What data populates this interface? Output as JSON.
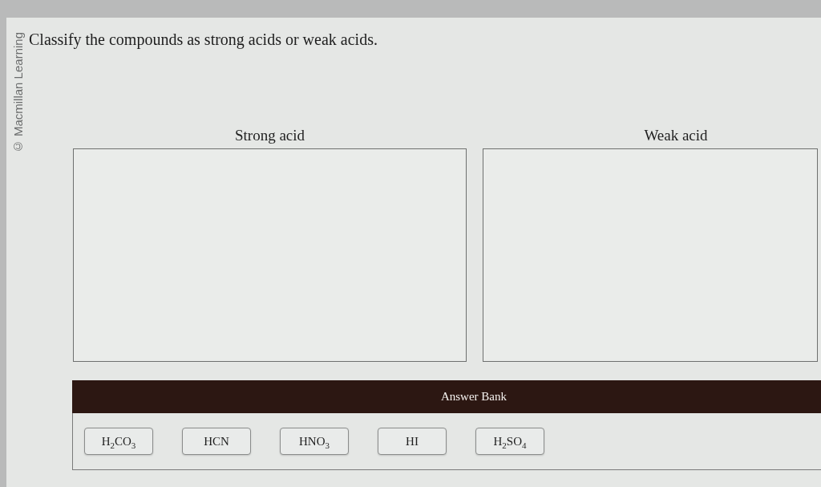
{
  "copyright_notice": "© Macmillan Learning",
  "question": "Classify the compounds as strong acids or weak acids.",
  "categories": [
    {
      "label": "Strong acid"
    },
    {
      "label": "Weak acid"
    }
  ],
  "answer_bank": {
    "title": "Answer Bank",
    "items": [
      "H$_{2}$CO$_{3}$",
      "HCN",
      "HNO$_{3}$",
      "HI",
      "H$_{2}$SO$_{4}$"
    ]
  }
}
